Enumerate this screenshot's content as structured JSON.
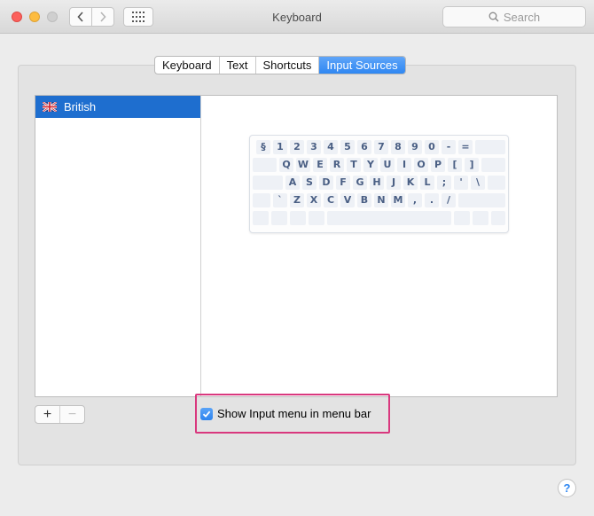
{
  "window": {
    "title": "Keyboard"
  },
  "search": {
    "placeholder": "Search"
  },
  "tabs": [
    {
      "label": "Keyboard",
      "active": false
    },
    {
      "label": "Text",
      "active": false
    },
    {
      "label": "Shortcuts",
      "active": false
    },
    {
      "label": "Input Sources",
      "active": true
    }
  ],
  "input_sources": [
    {
      "label": "British",
      "flag": "uk-flag-icon",
      "selected": true
    }
  ],
  "keyboard_rows": [
    [
      "§",
      "1",
      "2",
      "3",
      "4",
      "5",
      "6",
      "7",
      "8",
      "9",
      "0",
      "-",
      "="
    ],
    [
      "Q",
      "W",
      "E",
      "R",
      "T",
      "Y",
      "U",
      "I",
      "O",
      "P",
      "[",
      "]"
    ],
    [
      "A",
      "S",
      "D",
      "F",
      "G",
      "H",
      "J",
      "K",
      "L",
      ";",
      "'",
      "\\"
    ],
    [
      "`",
      "Z",
      "X",
      "C",
      "V",
      "B",
      "N",
      "M",
      ",",
      ".",
      "/"
    ]
  ],
  "buttons": {
    "add": "+",
    "remove": "−",
    "help": "?"
  },
  "show_input_menu": {
    "label": "Show Input menu in menu bar",
    "checked": true
  },
  "colors": {
    "accent": "#2f87f2",
    "selection": "#1e6ecf",
    "highlight": "#d9387e"
  }
}
